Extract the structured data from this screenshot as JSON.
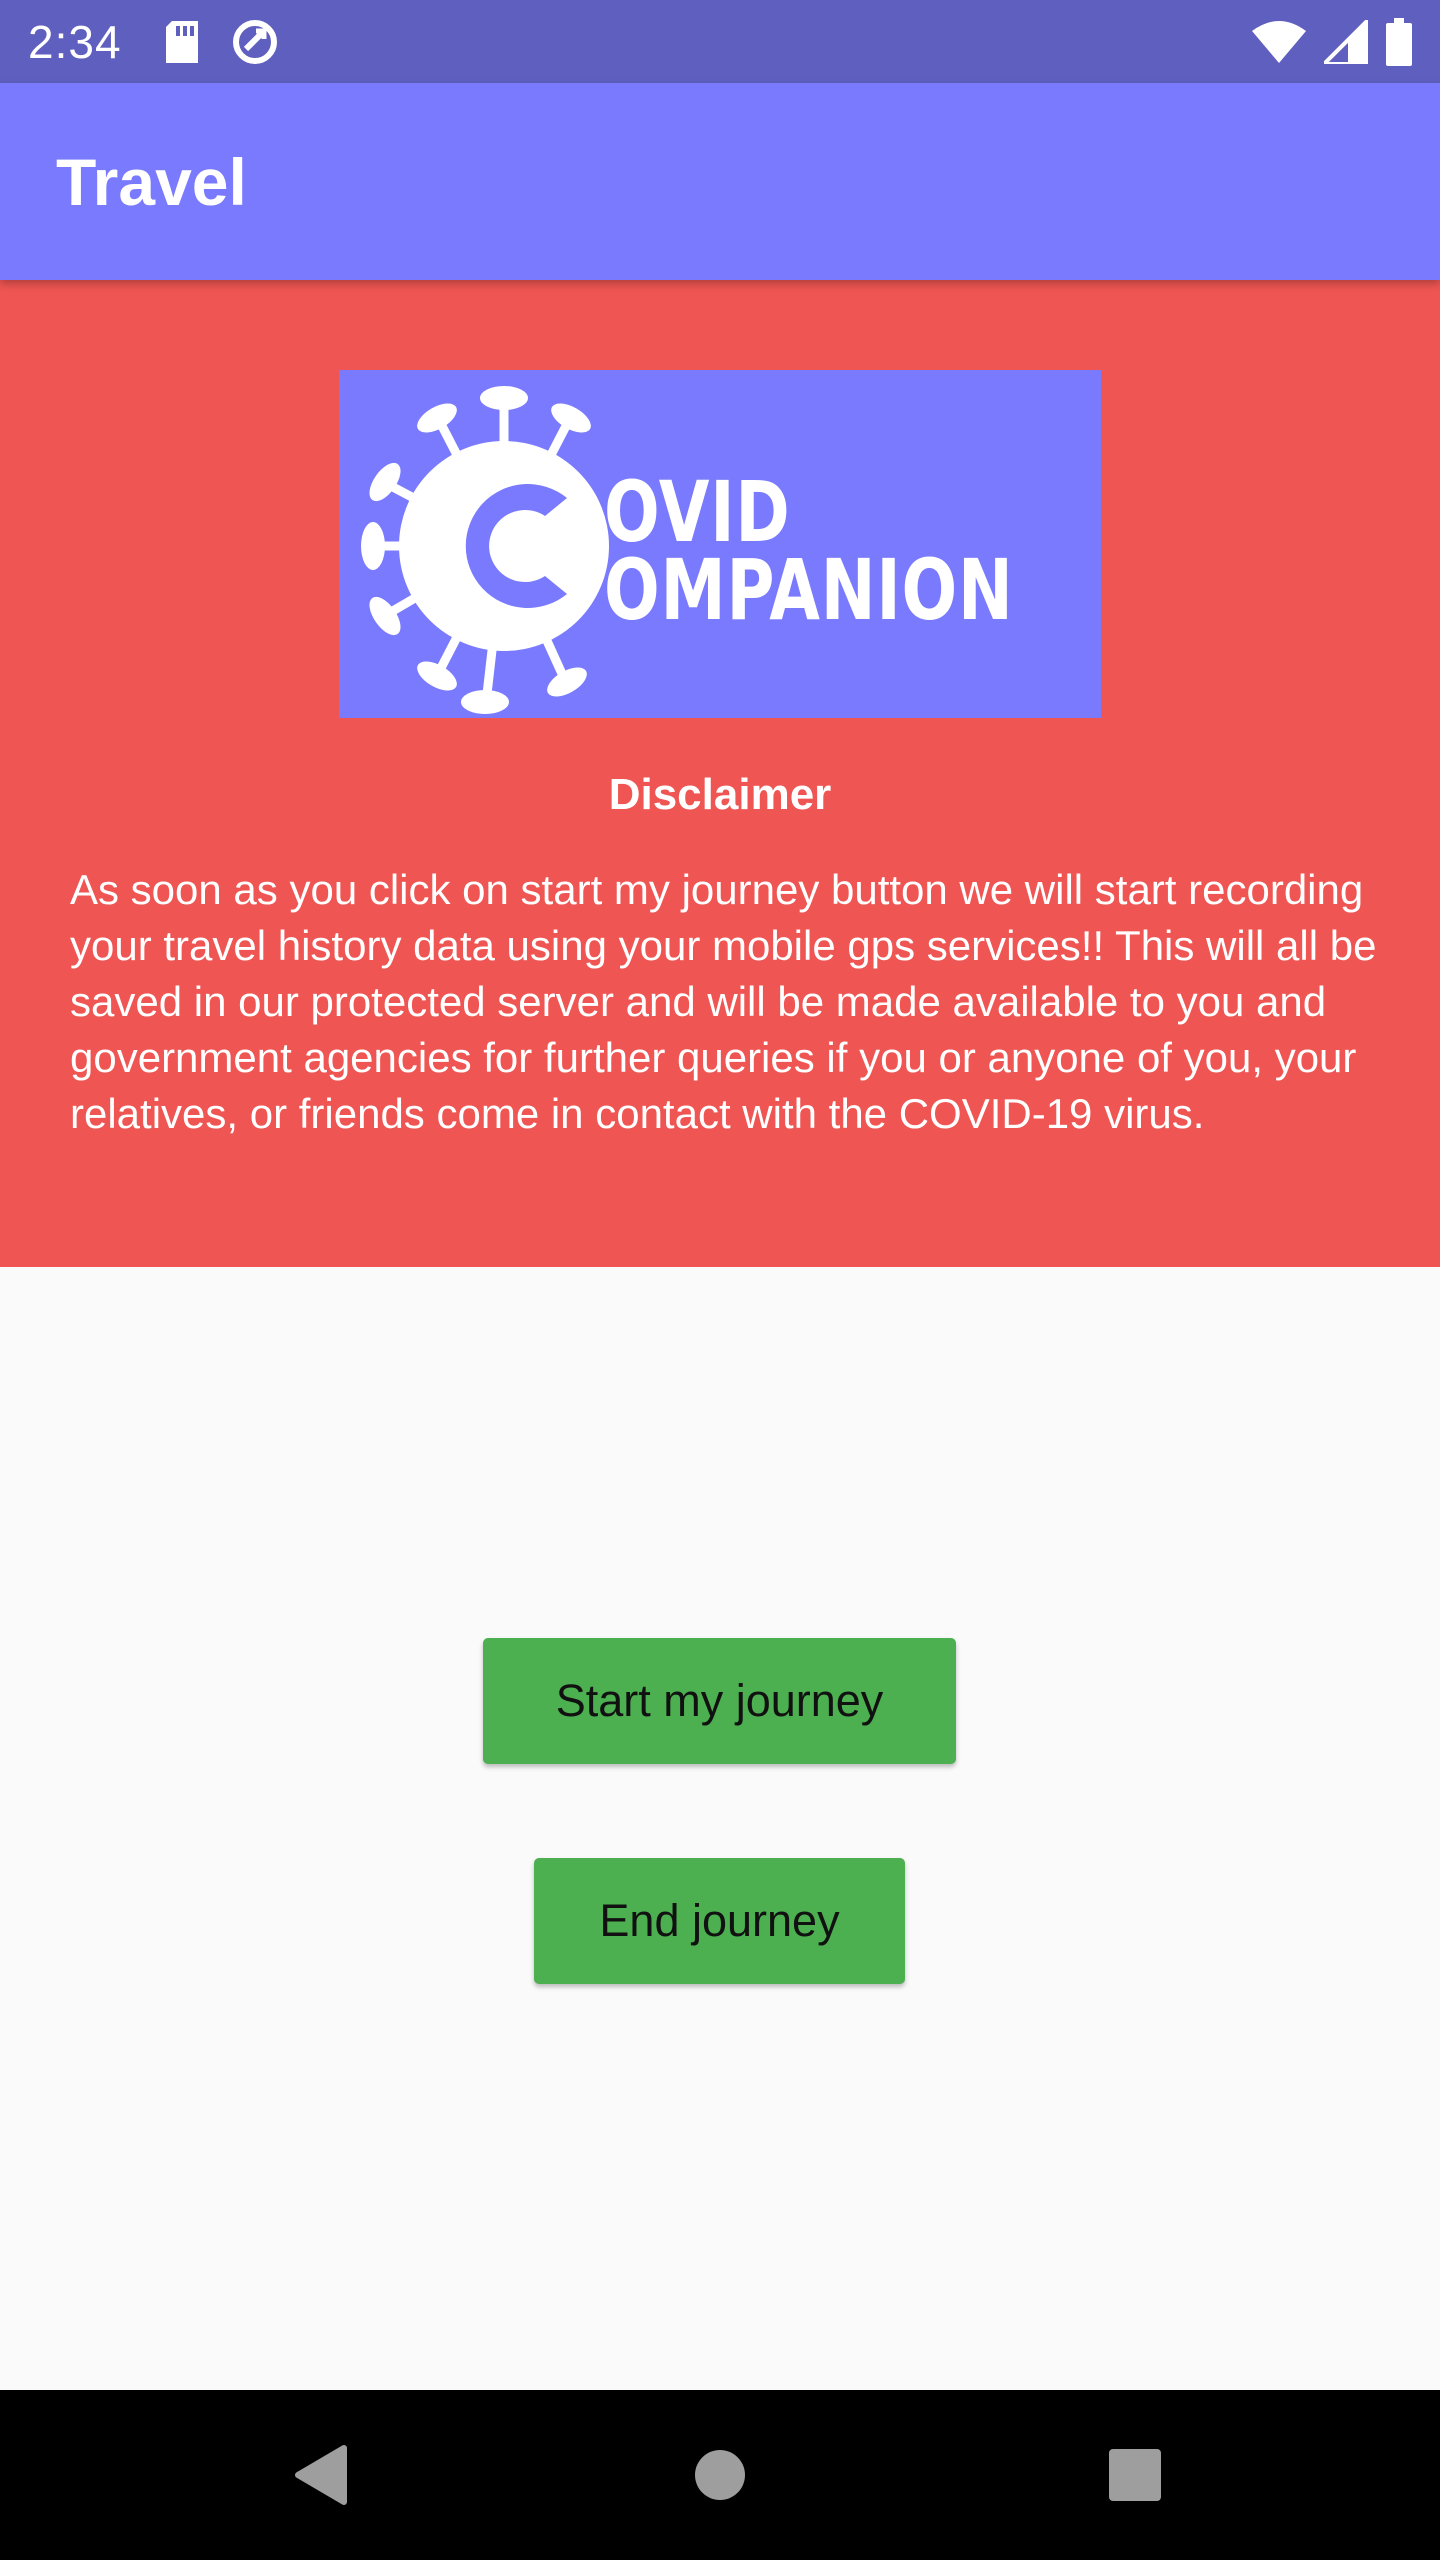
{
  "status_bar": {
    "time": "2:34",
    "icons": [
      "sd-card-icon",
      "sync-icon",
      "wifi-icon",
      "signal-icon",
      "battery-icon"
    ]
  },
  "app_bar": {
    "title": "Travel",
    "background": "#7a7aff"
  },
  "logo": {
    "line1": "OVID",
    "line2": "OMPANION"
  },
  "disclaimer": {
    "title": "Disclaimer",
    "body": "As soon as you click on start my journey button we will start recording your travel history data using your mobile gps services!! This will all be saved in our protected server and will be made available to you and government agencies for further queries if you or anyone of you, your relatives, or friends come in contact with the COVID-19 virus.",
    "background": "#ef5552"
  },
  "actions": {
    "start_label": "Start my journey",
    "end_label": "End journey",
    "button_color": "#4caf50"
  },
  "nav": {
    "icons": [
      "back-icon",
      "home-icon",
      "recents-icon"
    ]
  }
}
